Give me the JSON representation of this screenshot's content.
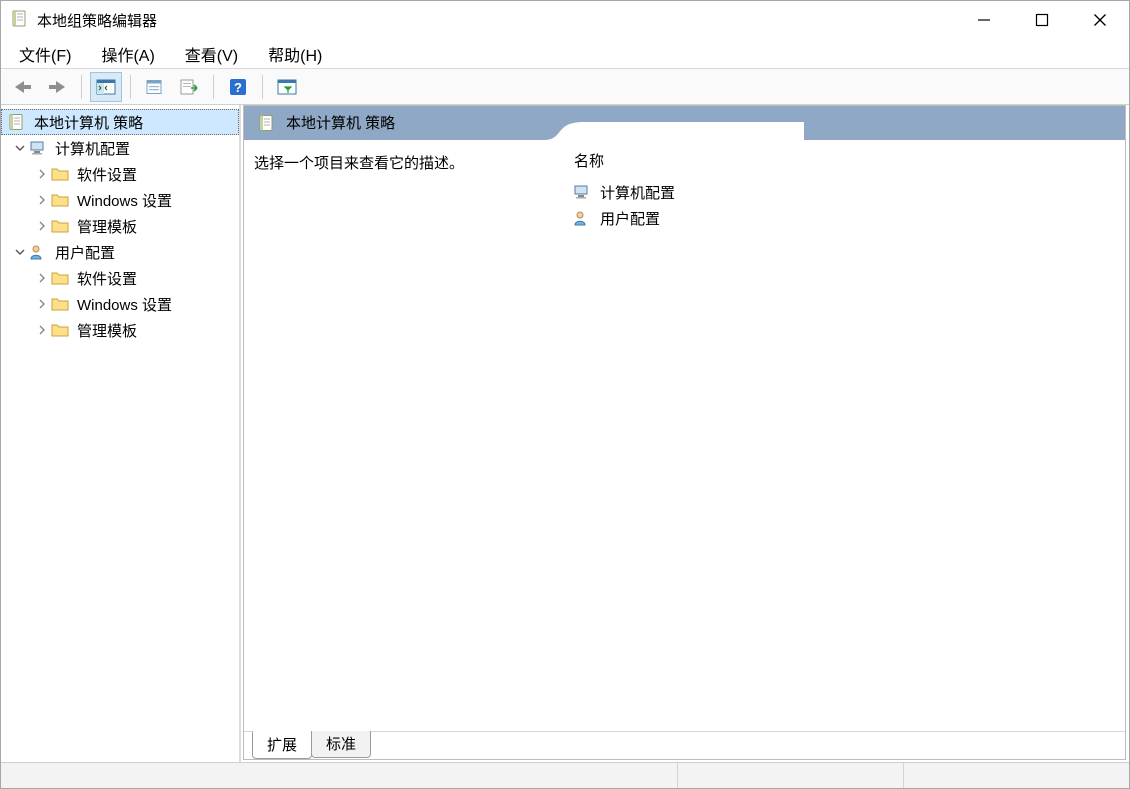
{
  "window": {
    "title": "本地组策略编辑器"
  },
  "menu": {
    "file": "文件(F)",
    "action": "操作(A)",
    "view": "查看(V)",
    "help": "帮助(H)"
  },
  "tree": {
    "root": "本地计算机 策略",
    "computer_config": "计算机配置",
    "user_config": "用户配置",
    "software_settings": "软件设置",
    "windows_settings": "Windows 设置",
    "admin_templates": "管理模板"
  },
  "right": {
    "header_title": "本地计算机 策略",
    "description_prompt": "选择一个项目来查看它的描述。",
    "list_header": "名称",
    "items": [
      {
        "label": "计算机配置"
      },
      {
        "label": "用户配置"
      }
    ]
  },
  "tabs": {
    "extended": "扩展",
    "standard": "标准"
  }
}
